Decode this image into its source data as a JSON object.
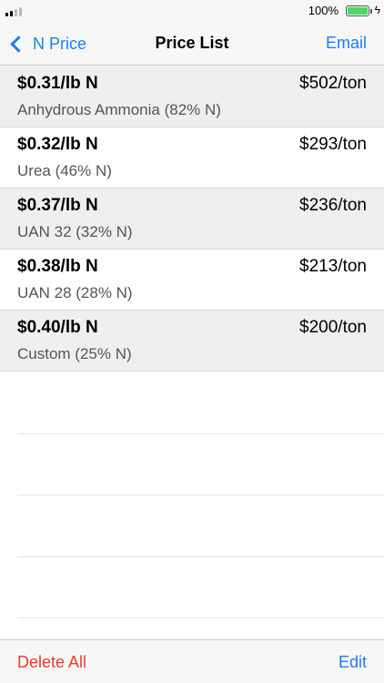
{
  "status": {
    "battery_percent": "100%",
    "signal_bars": 4,
    "signal_bars_filled": 2,
    "charging_icon": "bolt-icon"
  },
  "nav": {
    "back_label": "N Price",
    "title": "Price List",
    "email_label": "Email"
  },
  "items": [
    {
      "price": "$0.31/lb N",
      "ton": "$502/ton",
      "product": "Anhydrous Ammonia (82% N)"
    },
    {
      "price": "$0.32/lb N",
      "ton": "$293/ton",
      "product": "Urea (46% N)"
    },
    {
      "price": "$0.37/lb N",
      "ton": "$236/ton",
      "product": "UAN 32 (32% N)"
    },
    {
      "price": "$0.38/lb N",
      "ton": "$213/ton",
      "product": "UAN 28 (28% N)"
    },
    {
      "price": "$0.40/lb N",
      "ton": "$200/ton",
      "product": "Custom (25% N)"
    }
  ],
  "toolbar": {
    "delete_label": "Delete All",
    "edit_label": "Edit"
  },
  "colors": {
    "accent": "#1a7ef5",
    "destructive": "#f0392d",
    "battery": "#4cd964",
    "row_shade": "#efefef"
  }
}
